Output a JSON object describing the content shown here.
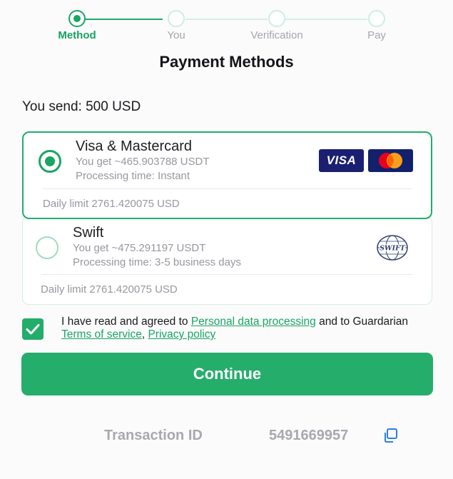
{
  "stepper": {
    "steps": [
      {
        "label": "Method",
        "active": true
      },
      {
        "label": "You",
        "active": false
      },
      {
        "label": "Verification",
        "active": false
      },
      {
        "label": "Pay",
        "active": false
      }
    ]
  },
  "page_title": "Payment Methods",
  "send_summary": "You send: 500 USD",
  "methods": [
    {
      "name": "Visa & Mastercard",
      "you_get": "You get ~465.903788 USDT",
      "processing": "Processing time: Instant",
      "daily_limit": "Daily limit 2761.420075 USD",
      "selected": true,
      "logos": [
        "visa-logo",
        "mastercard-logo"
      ],
      "visa_text": "VISA"
    },
    {
      "name": "Swift",
      "you_get": "You get ~475.291197 USDT",
      "processing": "Processing time: 3-5 business days",
      "daily_limit": "Daily limit 2761.420075 USD",
      "selected": false,
      "logos": [
        "swift-logo"
      ],
      "swift_text": "SWIFT"
    }
  ],
  "agreement": {
    "checked": true,
    "text_1": "I have read and agreed to ",
    "link_personal": "Personal data processing",
    "text_2": " and to Guardarian ",
    "link_terms": "Terms of service",
    "text_3": ", ",
    "link_privacy": "Privacy policy"
  },
  "continue_label": "Continue",
  "transaction": {
    "label": "Transaction ID",
    "value": "5491669957",
    "icon": "copy-icon"
  },
  "colors": {
    "accent": "#1aa564",
    "button": "#25ad6c",
    "visa_blue": "#1a1f71",
    "muted_text": "#97979f"
  }
}
